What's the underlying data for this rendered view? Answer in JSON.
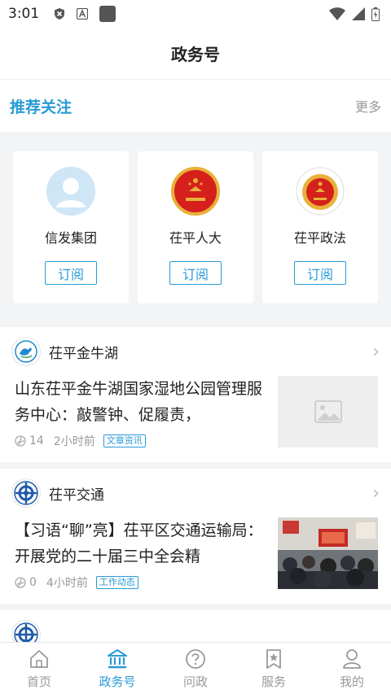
{
  "status_bar": {
    "time": "3:01",
    "icons": [
      "shield-x-icon",
      "a-badge-icon",
      "app-square-icon",
      "wifi-icon",
      "signal-icon",
      "battery-icon"
    ]
  },
  "header": {
    "title": "政务号"
  },
  "recommend": {
    "title": "推荐关注",
    "more": "更多",
    "cards": [
      {
        "name": "信发集团",
        "subscribe": "订阅",
        "icon": "default-avatar-icon"
      },
      {
        "name": "茌平人大",
        "subscribe": "订阅",
        "icon": "national-emblem-icon"
      },
      {
        "name": "茌平政法",
        "subscribe": "订阅",
        "icon": "political-legal-emblem-icon"
      }
    ]
  },
  "feed": [
    {
      "source": "茌平金牛湖",
      "headline": "山东茌平金牛湖国家湿地公园管理服务中心：敲警钟、促履责，",
      "views": "14",
      "time": "2小时前",
      "tag": "文章资讯",
      "thumb": "image-placeholder-icon"
    },
    {
      "source": "茌平交通",
      "headline": "【习语“聊”亮】茌平区交通运输局：开展党的二十届三中全会精",
      "views": "0",
      "time": "4小时前",
      "tag": "工作动态",
      "thumb": "meeting-photo"
    }
  ],
  "tabbar": {
    "tabs": [
      {
        "label": "首页",
        "icon": "home-icon"
      },
      {
        "label": "政务号",
        "icon": "government-building-icon",
        "active": true
      },
      {
        "label": "问政",
        "icon": "question-icon"
      },
      {
        "label": "服务",
        "icon": "star-bookmark-icon"
      },
      {
        "label": "我的",
        "icon": "user-icon"
      }
    ]
  },
  "colors": {
    "accent": "#2a9ad6",
    "muted": "#999999",
    "background_gray": "#f3f4f6",
    "emblem_red": "#d5201c"
  }
}
